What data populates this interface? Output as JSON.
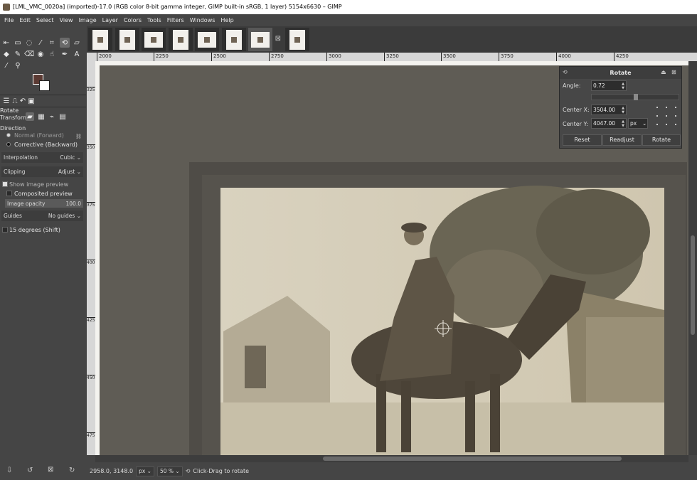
{
  "window": {
    "title": "[LML_VMC_0020a] (imported)-17.0 (RGB color 8-bit gamma integer, GIMP built-in sRGB, 1 layer) 5154x6630 – GIMP"
  },
  "menu": [
    "File",
    "Edit",
    "Select",
    "View",
    "Image",
    "Layer",
    "Colors",
    "Tools",
    "Filters",
    "Windows",
    "Help"
  ],
  "thumbnails": {
    "close_glyph": "⊠"
  },
  "tool_options": {
    "title": "Rotate",
    "transform_label": "Transform:",
    "direction_label": "Direction",
    "direction_normal": "Normal (Forward)",
    "direction_corrective": "Corrective (Backward)",
    "interpolation_label": "Interpolation",
    "interpolation_value": "Cubic",
    "clipping_label": "Clipping",
    "clipping_value": "Adjust",
    "show_preview": "Show image preview",
    "composited_preview": "Composited preview",
    "image_opacity_label": "Image opacity",
    "image_opacity_value": "100.0",
    "guides_label": "Guides",
    "guides_value": "No guides",
    "degrees_label": "15 degrees (Shift)"
  },
  "ruler": {
    "h_labels": [
      "2000",
      "2250",
      "2500",
      "2750",
      "3000",
      "3250",
      "3500",
      "3750",
      "4000",
      "4250"
    ],
    "v_labels": [
      "3250",
      "3500",
      "3750",
      "4000",
      "4250",
      "4500",
      "4750",
      "5000"
    ]
  },
  "rotate_dialog": {
    "title": "Rotate",
    "angle_label": "Angle:",
    "angle_value": "0.72",
    "center_x_label": "Center X:",
    "center_x_value": "3504.00",
    "center_y_label": "Center Y:",
    "center_y_value": "4047.00",
    "unit": "px",
    "reset_label": "Reset",
    "readjust_label": "Readjust",
    "rotate_label": "Rotate"
  },
  "status": {
    "coords": "2958.0, 3148.0",
    "unit": "px",
    "zoom": "50 %",
    "message": "Click-Drag to rotate"
  }
}
